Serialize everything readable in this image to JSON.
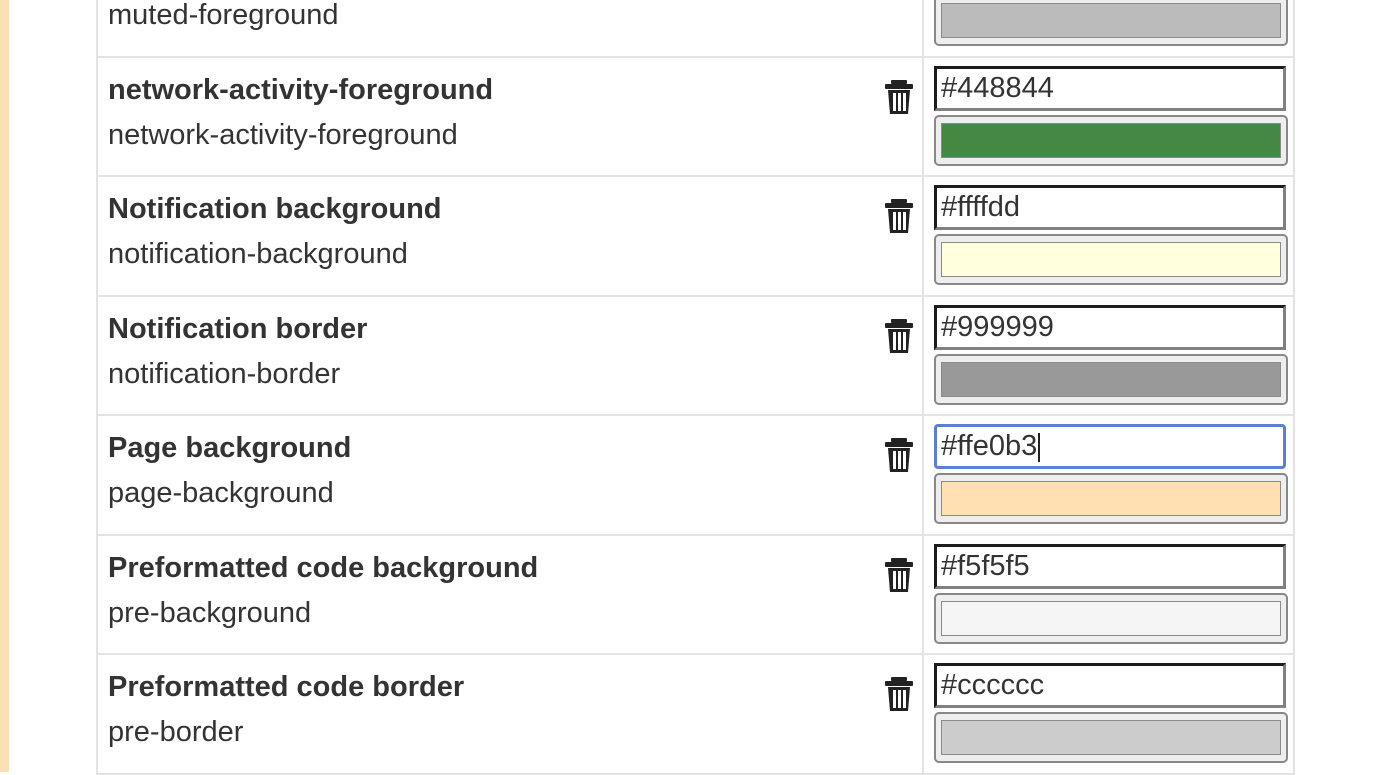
{
  "rows": [
    {
      "title": "",
      "key": "muted-foreground",
      "value": "",
      "color": "#bbbbbb",
      "show_hex": false,
      "show_delete": false,
      "focused": false
    },
    {
      "title": "network-activity-foreground",
      "key": "network-activity-foreground",
      "value": "#448844",
      "color": "#448844",
      "show_hex": true,
      "show_delete": true,
      "focused": false
    },
    {
      "title": "Notification background",
      "key": "notification-background",
      "value": "#ffffdd",
      "color": "#ffffdd",
      "show_hex": true,
      "show_delete": true,
      "focused": false
    },
    {
      "title": "Notification border",
      "key": "notification-border",
      "value": "#999999",
      "color": "#999999",
      "show_hex": true,
      "show_delete": true,
      "focused": false
    },
    {
      "title": "Page background",
      "key": "page-background",
      "value": "#ffe0b3",
      "color": "#ffe0b3",
      "show_hex": true,
      "show_delete": true,
      "focused": true
    },
    {
      "title": "Preformatted code background",
      "key": "pre-background",
      "value": "#f5f5f5",
      "color": "#f5f5f5",
      "show_hex": true,
      "show_delete": true,
      "focused": false
    },
    {
      "title": "Preformatted code border",
      "key": "pre-border",
      "value": "#cccccc",
      "color": "#cccccc",
      "show_hex": true,
      "show_delete": true,
      "focused": false
    }
  ],
  "icons": {
    "delete": "trash-icon"
  },
  "colors": {
    "page_edge": "#fbe0b6",
    "focus_ring": "#5b7fd1"
  }
}
